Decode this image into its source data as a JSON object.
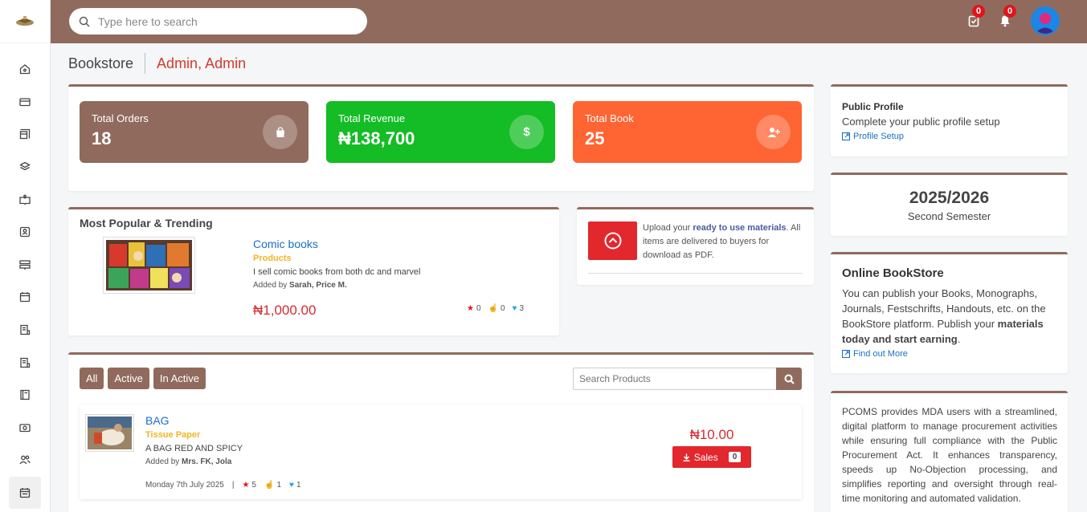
{
  "search": {
    "placeholder": "Type here to search"
  },
  "topbar": {
    "tasks_count": "0",
    "notifications_count": "0"
  },
  "breadcrumb": {
    "section": "Bookstore",
    "user": "Admin, Admin"
  },
  "stats": [
    {
      "label": "Total Orders",
      "value": "18",
      "color": "#906b5d"
    },
    {
      "label": "Total Revenue",
      "value": "₦138,700",
      "color": "#14bc25"
    },
    {
      "label": "Total Book",
      "value": "25",
      "color": "#ff6433"
    }
  ],
  "popular": {
    "heading": "Most Popular & Trending",
    "title": "Comic books",
    "category": "Products",
    "description": "I sell comic books from both dc and marvel",
    "added_by_prefix": "Added by",
    "added_by": "Sarah, Price M.",
    "price": "₦1,000.00",
    "stars": "0",
    "likes": "0",
    "hearts": "3"
  },
  "upload": {
    "text1": "Upload your ",
    "bold": "ready to use materials",
    "text2": ". All items are delivered to buyers for download as PDF."
  },
  "filters": {
    "all": "All",
    "active": "Active",
    "inactive": "In Active",
    "search_placeholder": "Search Products"
  },
  "product": {
    "title": "BAG",
    "category": "Tissue Paper",
    "description": "A BAG RED AND SPICY",
    "added_by_prefix": "Added by",
    "added_by": "Mrs. FK, Jola",
    "date": "Monday 7th July 2025",
    "sep": "|",
    "stars": "5",
    "likes": "1",
    "hearts": "1",
    "price": "₦10.00",
    "sales_label": "Sales",
    "sales_count": "0"
  },
  "profile": {
    "title": "Public Profile",
    "subtitle": "Complete your public profile setup",
    "link": "Profile Setup"
  },
  "session": {
    "year": "2025/2026",
    "semester": "Second Semester"
  },
  "online": {
    "title": "Online BookStore",
    "text1": "You can publish your Books, Monographs, Journals, Festschrifts, Handouts, etc. on the BookStore platform. Publish your ",
    "bold": "materials today and start earning",
    "text2": ".",
    "link": "Find out More"
  },
  "pcoms": {
    "text": "PCOMS provides MDA users with a streamlined, digital platform to manage procurement activities while ensuring full compliance with the Public Procurement Act. It enhances transparency, speeds up No-Objection processing, and simplifies reporting and oversight through real-time monitoring and automated validation."
  },
  "sidebar": {
    "icons": [
      "home-icon",
      "card-icon",
      "store-icon",
      "layers-icon",
      "book-open-icon",
      "contact-icon",
      "server-icon",
      "calendar-icon",
      "receipt-icon",
      "receipt2-icon",
      "notebook-icon",
      "money-icon",
      "users-icon",
      "calendar-active-icon"
    ]
  },
  "colors": {
    "brand": "#906b5d",
    "danger": "#e2272d",
    "link": "#1b6fc4",
    "category": "#f5b323"
  }
}
